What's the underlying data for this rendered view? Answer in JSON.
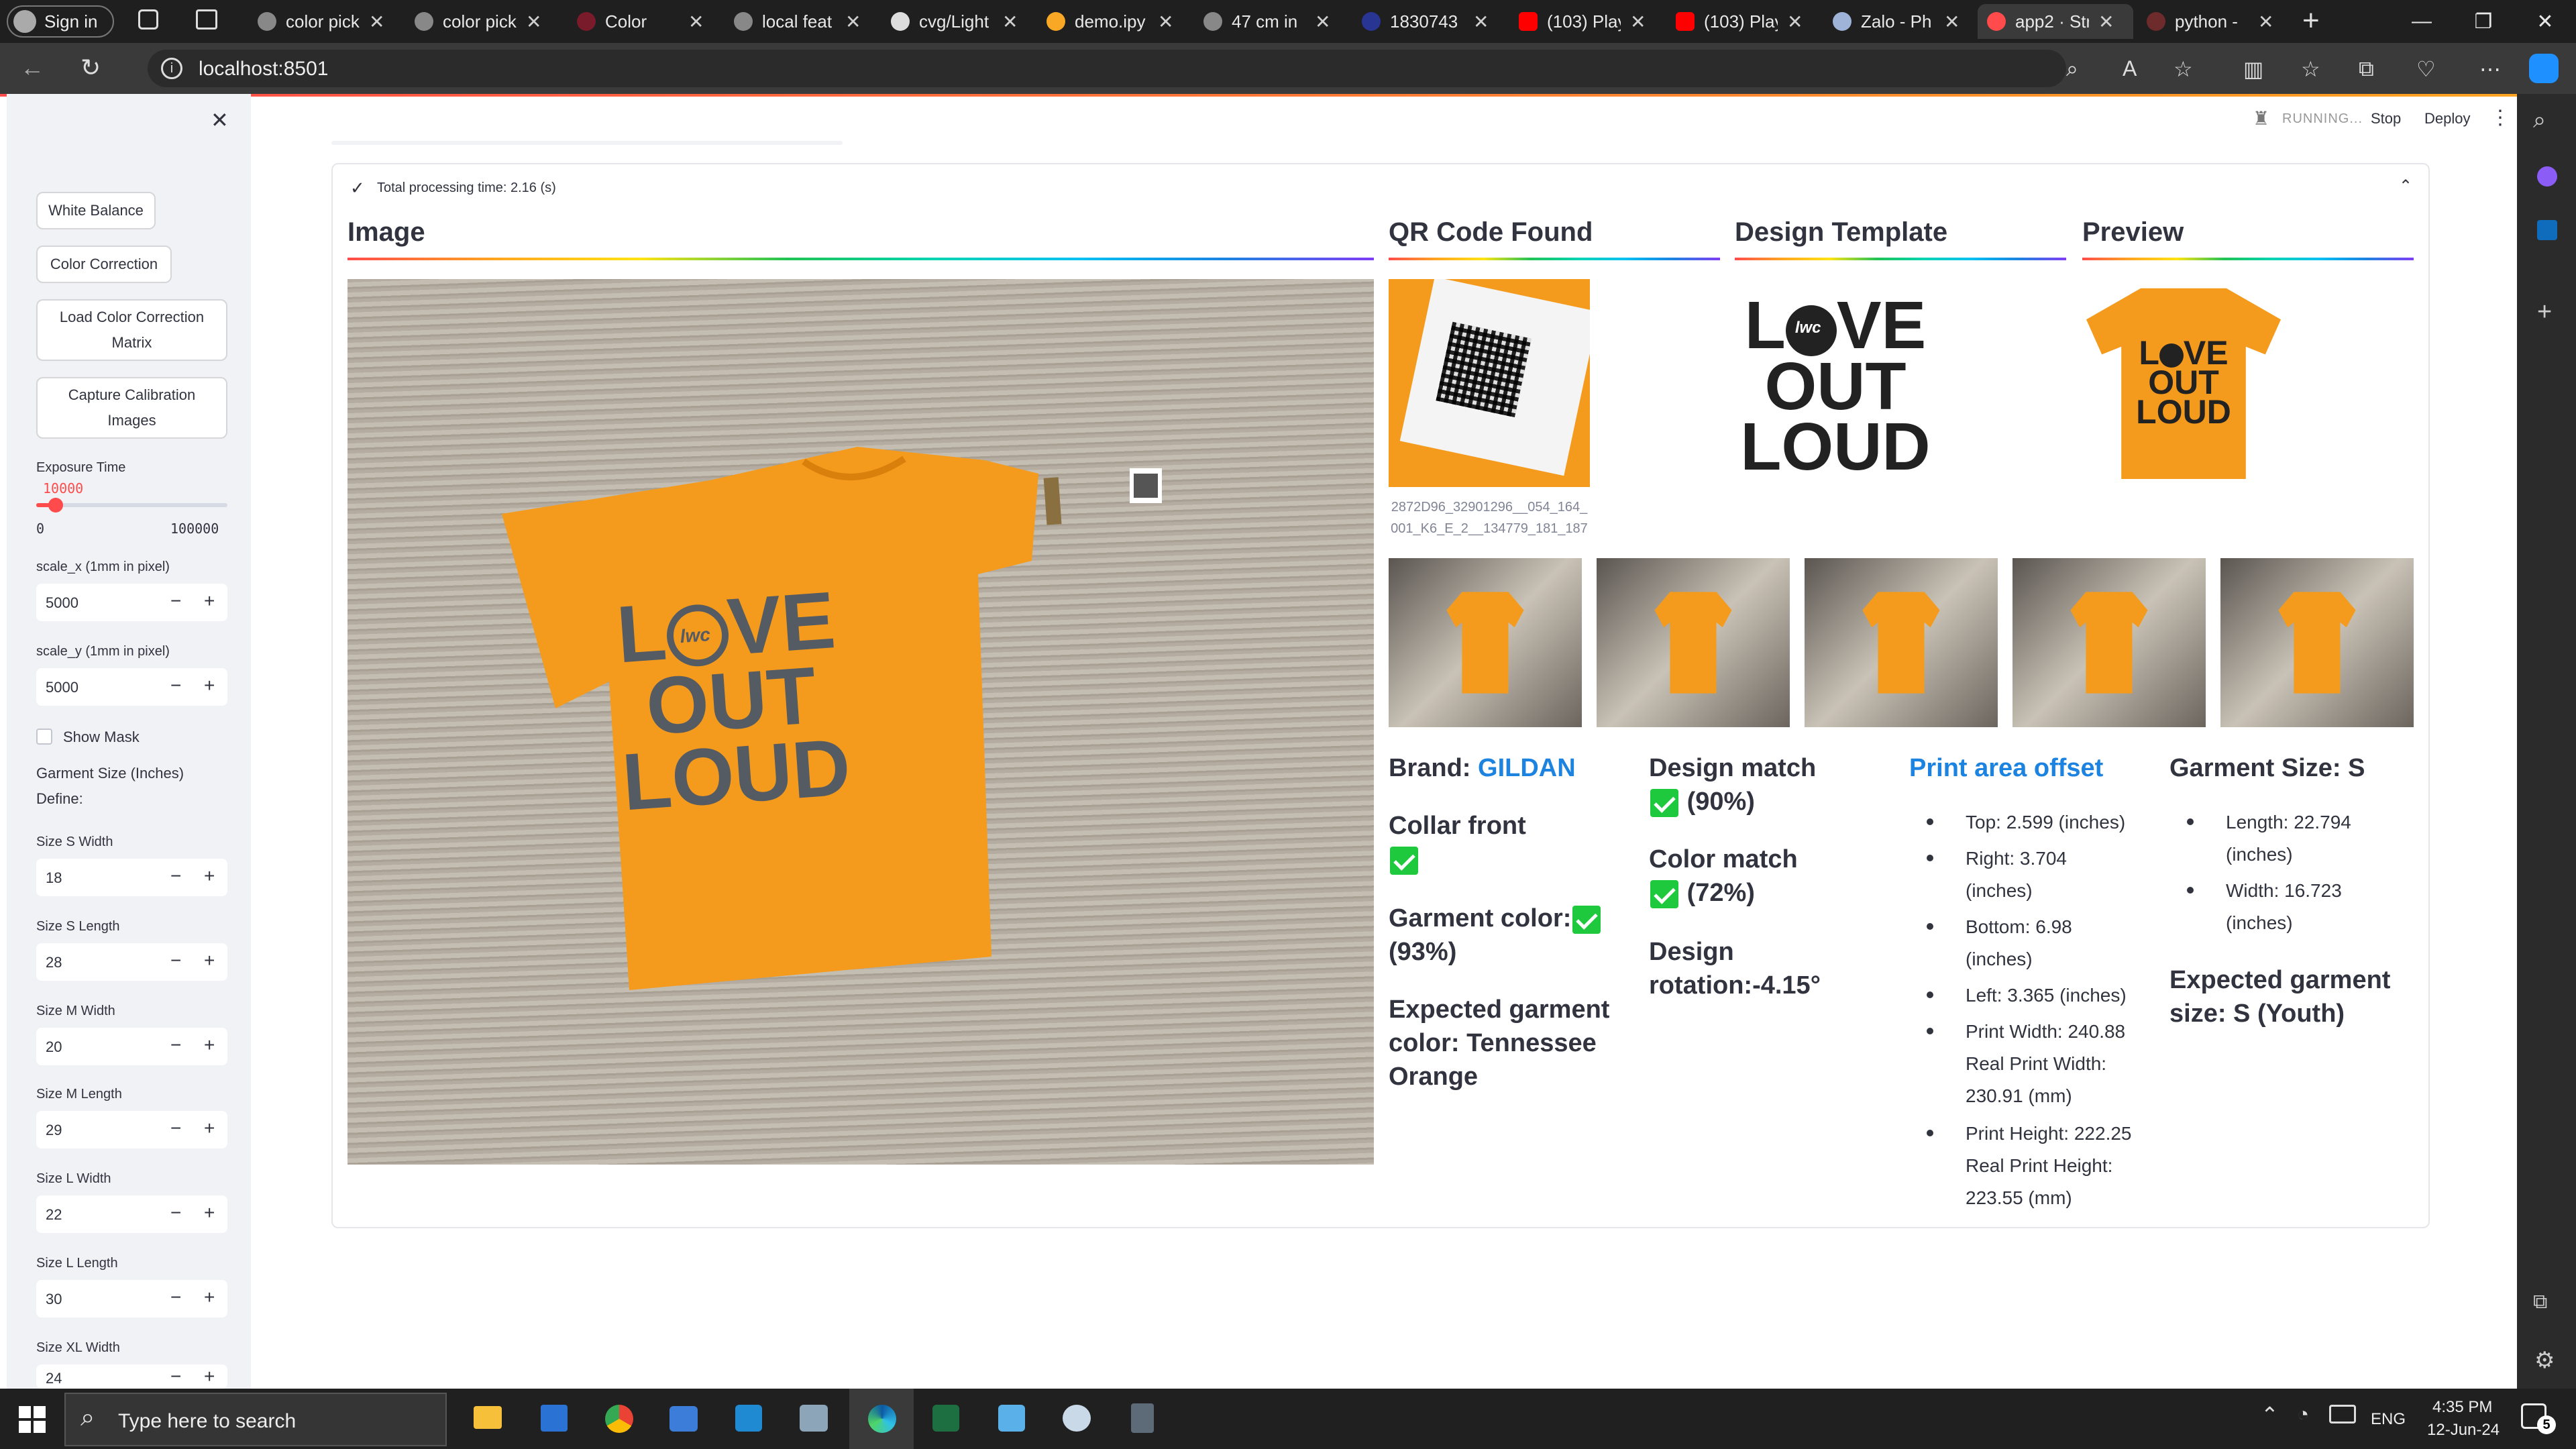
{
  "browser": {
    "profile_label": "Sign in",
    "tabs": [
      {
        "label": "color pick"
      },
      {
        "label": "color pick"
      },
      {
        "label": "Color"
      },
      {
        "label": "local feat"
      },
      {
        "label": "cvg/Light"
      },
      {
        "label": "demo.ipy"
      },
      {
        "label": "47 cm in"
      },
      {
        "label": "1830743"
      },
      {
        "label": "(103) Play"
      },
      {
        "label": "(103) Play"
      },
      {
        "label": "Zalo - Ph"
      },
      {
        "label": "app2 · Str"
      },
      {
        "label": "python -"
      }
    ],
    "address": "localhost:8501"
  },
  "app_header": {
    "status": "RUNNING...",
    "stop_label": "Stop",
    "deploy_label": "Deploy"
  },
  "sidebar": {
    "buttons": {
      "white_balance": "White Balance",
      "color_correction": "Color Correction",
      "load_matrix": "Load Color Correction Matrix",
      "capture_calibration": "Capture Calibration Images"
    },
    "exposure": {
      "label": "Exposure Time",
      "value": "10000",
      "min": "0",
      "max": "100000",
      "fraction": 0.1
    },
    "scale_x": {
      "label": "scale_x (1mm in pixel)",
      "value": "5000"
    },
    "scale_y": {
      "label": "scale_y (1mm in pixel)",
      "value": "5000"
    },
    "show_mask": "Show Mask",
    "garment_size_title": "Garment Size (Inches)",
    "define_label": "Define:",
    "sizes": [
      {
        "label": "Size S Width",
        "value": "18"
      },
      {
        "label": "Size S Length",
        "value": "28"
      },
      {
        "label": "Size M Width",
        "value": "20"
      },
      {
        "label": "Size M Length",
        "value": "29"
      },
      {
        "label": "Size L Width",
        "value": "22"
      },
      {
        "label": "Size L Length",
        "value": "30"
      },
      {
        "label": "Size XL Width",
        "value": "24"
      }
    ]
  },
  "main": {
    "status_line": "Total processing time: 2.16 (s)",
    "image_title": "Image",
    "qr_title": "QR Code Found",
    "qr_caption": "2872D96_32901296__054_164_001_K6_E_2__134779_181_187",
    "design_title": "Design Template",
    "preview_title": "Preview",
    "design_text": [
      "L",
      "VE",
      "OUT",
      "LOUD"
    ],
    "design_logo": "lwc",
    "brand_label": "Brand:",
    "brand_value": "GILDAN",
    "collar_front": "Collar front",
    "garment_color_label": "Garment color:",
    "garment_color_pct": "(93%)",
    "expected_color": "Expected garment color: Tennessee Orange",
    "design_match_label": "Design match",
    "design_match_pct": "(90%)",
    "color_match_label": "Color match",
    "color_match_pct": "(72%)",
    "design_rotation": "Design rotation:-4.15°",
    "print_area_title": "Print area offset",
    "print_area": [
      "Top: 2.599 (inches)",
      "Right: 3.704 (inches)",
      "Bottom: 6.98 (inches)",
      "Left: 3.365 (inches)",
      "Print Width: 240.88 Real Print Width: 230.91 (mm)",
      "Print Height: 222.25 Real Print Height: 223.55 (mm)"
    ],
    "garment_size_title": "Garment Size: S",
    "garment_size": [
      "Length: 22.794 (inches)",
      "Width: 16.723 (inches)"
    ],
    "expected_size": "Expected garment size: S (Youth)"
  },
  "taskbar": {
    "search_placeholder": "Type here to search",
    "time": "4:35 PM",
    "date": "12-Jun-24",
    "lang": "ENG",
    "notif_count": "5"
  },
  "colors": {
    "accent": "#ff4b4b",
    "link": "#1c83e1",
    "shirt": "#f49b1e"
  }
}
